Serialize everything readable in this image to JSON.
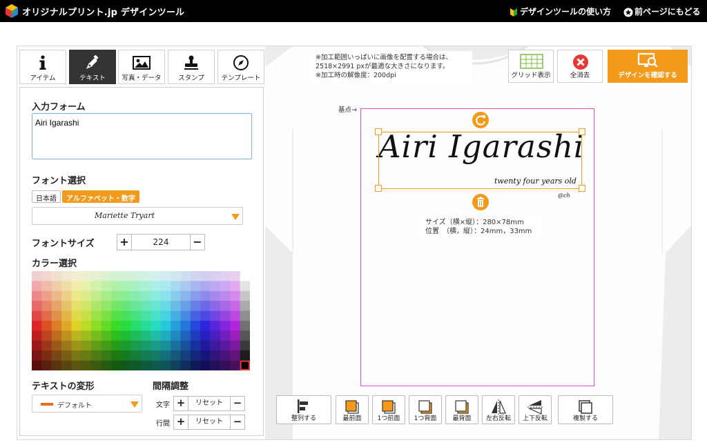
{
  "header": {
    "brand": "オリジナルプリント.jp デザインツール",
    "link_howto": "デザインツールの使い方",
    "link_back": "前ページにもどる"
  },
  "tabs": [
    {
      "label": "アイテム",
      "icon": "info-icon"
    },
    {
      "label": "テキスト",
      "icon": "pen-icon"
    },
    {
      "label": "写真・データ",
      "icon": "image-icon"
    },
    {
      "label": "スタンプ",
      "icon": "stamp-icon"
    },
    {
      "label": "テンプレート",
      "icon": "compass-icon"
    }
  ],
  "active_tab": "テキスト",
  "text_panel": {
    "input_title": "入力フォーム",
    "input_value": "Airi Igarashi",
    "font_title": "フォント選択",
    "lang_japanese": "日本語",
    "lang_alpha": "アルファベット・数字",
    "font_selected": "Mariette Tryart",
    "font_size_title": "フォントサイズ",
    "font_size_value": "224",
    "color_title": "カラー選択",
    "transform_title": "テキストの変形",
    "transform_value": "デフォルト",
    "spacing_title": "間隔調整",
    "spacing_char_label": "文字",
    "spacing_line_label": "行間",
    "reset_label": "リセット",
    "plus": "+",
    "minus": "−"
  },
  "canvas": {
    "note_lines": [
      "※加工範囲いっぱいに画像を配置する場合は、",
      "2518×2991 pxが最適な大きさになります。",
      "※加工時の解像度：200dpi"
    ],
    "grid_label": "グリッド表示",
    "clear_label": "全消去",
    "confirm_label": "デザインを確認する",
    "base_point": "基点→",
    "design_main": "Airi Igarashi",
    "design_sub": "twenty four years old",
    "design_tag": "@ch",
    "size_info": "サイズ（横×縦）：280×78mm",
    "position_info": "位置　（横，縦）：24mm，33mm"
  },
  "bottom_toolbar": [
    {
      "label": "整列する",
      "icon": "align-icon"
    },
    {
      "label": "最前面",
      "icon": "bring-front-icon"
    },
    {
      "label": "1つ前面",
      "icon": "bring-forward-icon"
    },
    {
      "label": "1つ背面",
      "icon": "send-backward-icon"
    },
    {
      "label": "最背面",
      "icon": "send-back-icon"
    },
    {
      "label": "左右反転",
      "icon": "flip-horizontal-icon"
    },
    {
      "label": "上下反転",
      "icon": "flip-vertical-icon"
    },
    {
      "label": "複製する",
      "icon": "duplicate-icon"
    }
  ],
  "colors": {
    "accent": "#f39a1c",
    "print_area": "#e14fd8",
    "input_border": "#7ab6e8"
  }
}
